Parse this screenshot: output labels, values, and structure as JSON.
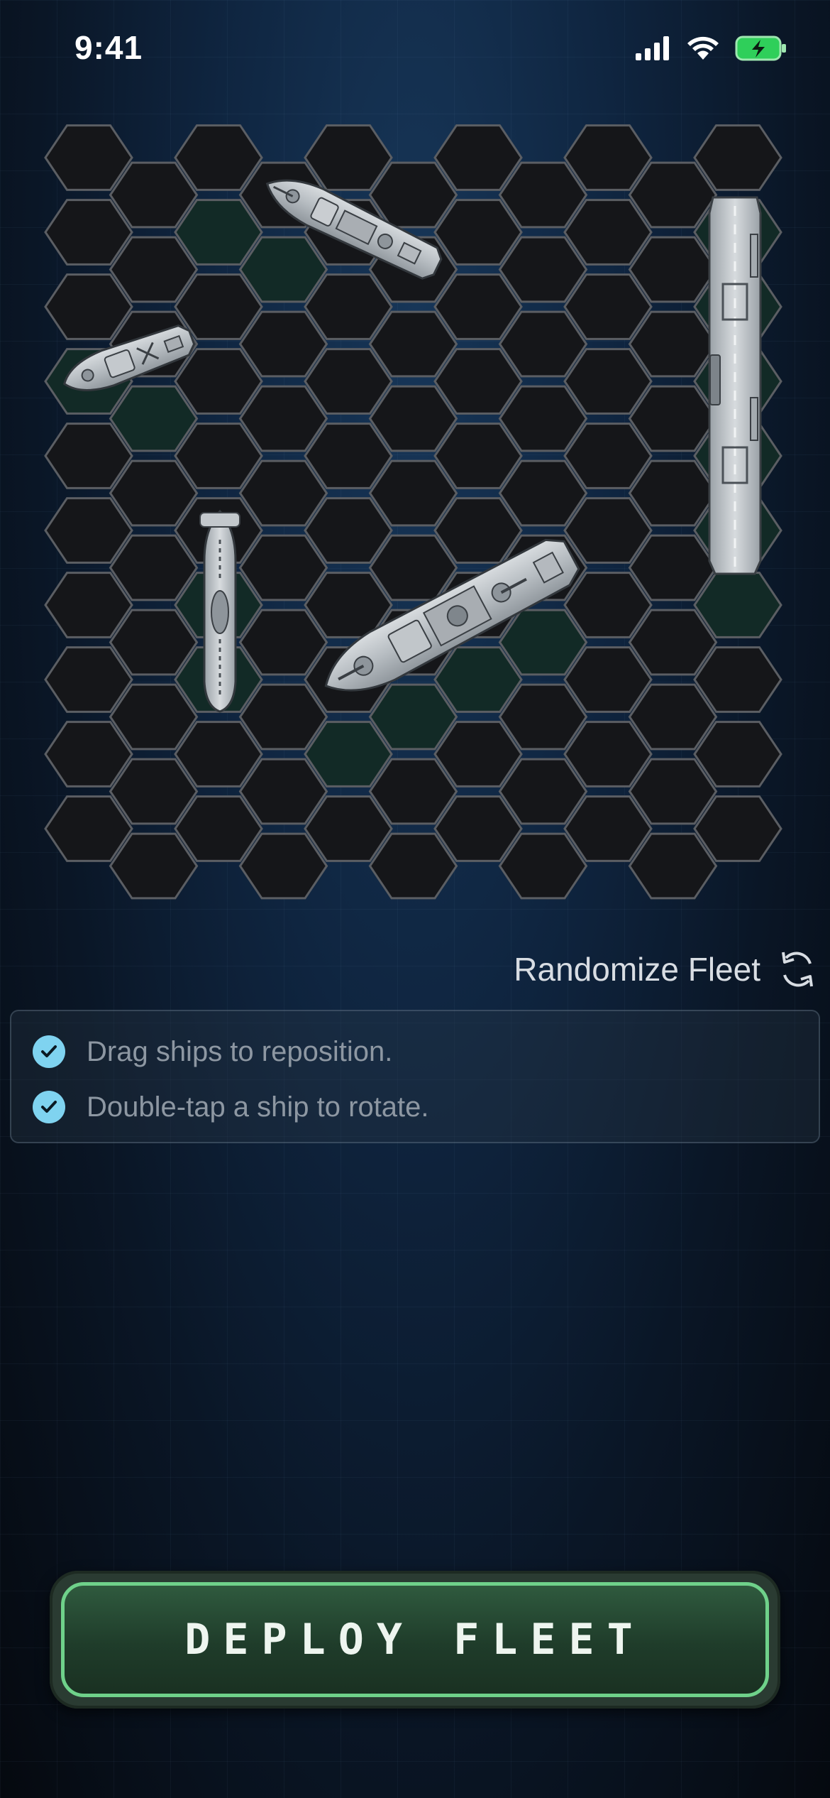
{
  "status_bar": {
    "time": "9:41",
    "signal_icon": "signal-bars-icon",
    "wifi_icon": "wifi-icon",
    "battery_icon": "battery-charging-icon"
  },
  "board": {
    "columns": 11,
    "rows": 10,
    "cell_fill": "#151619",
    "cell_stroke": "#5b5e63",
    "occupied_fill": "#122a26",
    "ships": [
      {
        "name": "aircraft-carrier",
        "icon": "carrier-ship-icon"
      },
      {
        "name": "destroyer",
        "icon": "destroyer-ship-icon"
      },
      {
        "name": "patrol-boat",
        "icon": "patrol-boat-icon"
      },
      {
        "name": "submarine",
        "icon": "submarine-icon"
      },
      {
        "name": "battleship",
        "icon": "battleship-icon"
      }
    ]
  },
  "randomize": {
    "label": "Randomize Fleet",
    "icon": "refresh-icon"
  },
  "tips": {
    "items": [
      {
        "text": "Drag ships to reposition.",
        "icon": "check-circle-icon"
      },
      {
        "text": "Double-tap a ship to rotate.",
        "icon": "check-circle-icon"
      }
    ]
  },
  "deploy_button": {
    "label": "DEPLOY FLEET",
    "accent": "#6fd18a"
  }
}
